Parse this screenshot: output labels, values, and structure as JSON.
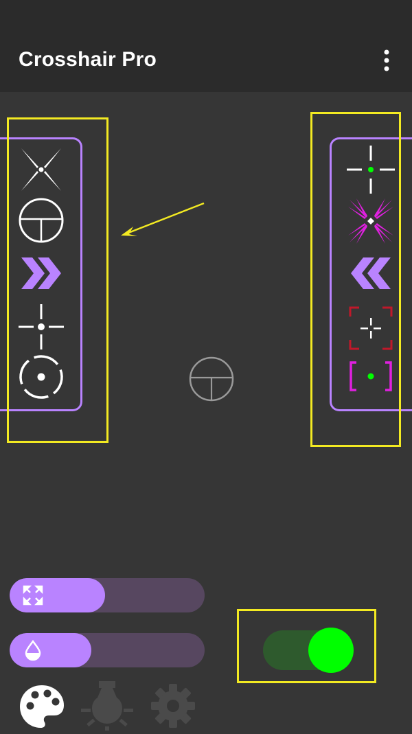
{
  "app": {
    "title": "Crosshair Pro"
  },
  "colors": {
    "accent": "#b983ff",
    "highlight": "#f3ea22",
    "toggle_on": "#00ff00",
    "toggle_track": "#2e5a2d",
    "appbar": "#2b2b2b",
    "background": "#363636"
  },
  "icons": {
    "menu": "more-vert-icon",
    "palette": "palette-icon",
    "brightness": "brightness-icon",
    "settings": "gear-icon",
    "size": "expand-icon",
    "opacity": "opacity-drop-icon"
  },
  "left_panel": {
    "crosshairs": [
      "x-dot",
      "scope-circle",
      "chevron-right",
      "cross-dot",
      "dashed-circle-dot"
    ]
  },
  "right_panel": {
    "crosshairs": [
      "cross-green-dot",
      "spiky-magenta-x",
      "chevron-left",
      "red-bracket-cross",
      "magenta-bracket-green-dot"
    ]
  },
  "controls": {
    "size_slider": {
      "value_fraction": 0.49
    },
    "opacity_slider": {
      "value_fraction": 0.42
    },
    "overlay_toggle": {
      "on": true
    }
  },
  "bottom_nav": {
    "selected": "palette"
  }
}
